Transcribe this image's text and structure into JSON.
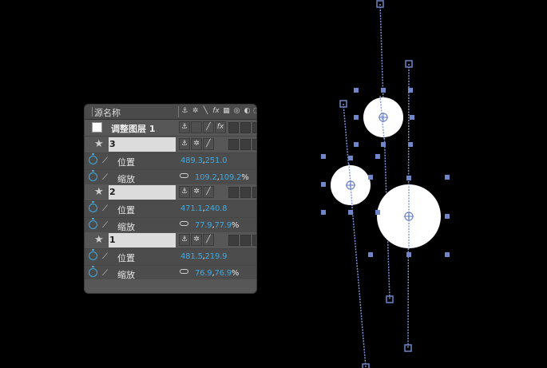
{
  "panel": {
    "header_title": "源名称",
    "adjustment_layer": {
      "name": "调整图层 1"
    },
    "layers": [
      {
        "index": "3",
        "props": [
          {
            "name": "位置",
            "v1": "489.3",
            "v2": "251.0",
            "pct": ""
          },
          {
            "name": "缩放",
            "v1": "109.2",
            "v2": "109.2",
            "pct": "%"
          }
        ]
      },
      {
        "index": "2",
        "props": [
          {
            "name": "位置",
            "v1": "471.1",
            "v2": "240.8",
            "pct": ""
          },
          {
            "name": "缩放",
            "v1": "77.9",
            "v2": "77.9",
            "pct": "%"
          }
        ]
      },
      {
        "index": "1",
        "props": [
          {
            "name": "位置",
            "v1": "481.5",
            "v2": "219.9",
            "pct": ""
          },
          {
            "name": "缩放",
            "v1": "76.9",
            "v2": "76.9",
            "pct": "%"
          }
        ]
      }
    ]
  },
  "colors": {
    "value_blue": "#3fa9df",
    "handle_blue": "#6f86c8",
    "path_blue": "#7d92d8"
  },
  "icons": [
    "stopwatch-icon",
    "graph-icon",
    "star-icon",
    "link-icon",
    "anchor-icon",
    "fx-icon"
  ]
}
